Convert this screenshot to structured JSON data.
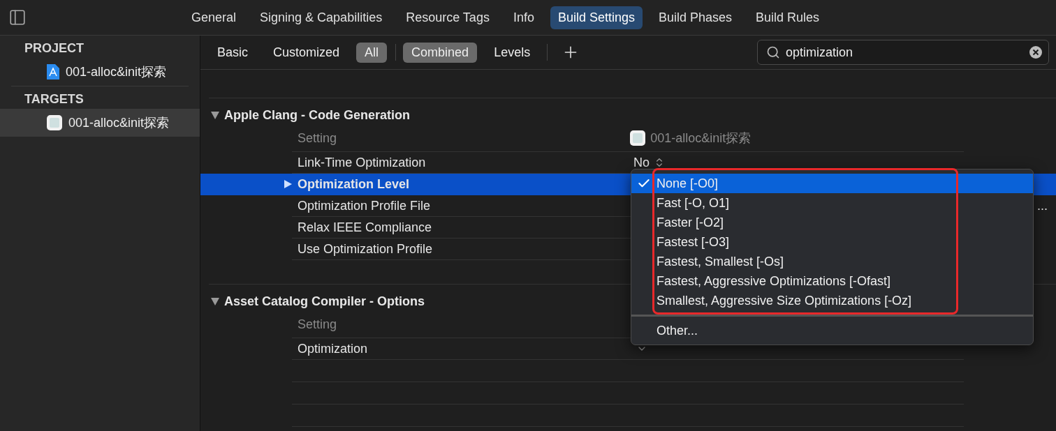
{
  "tabs": [
    {
      "label": "General",
      "selected": false
    },
    {
      "label": "Signing & Capabilities",
      "selected": false
    },
    {
      "label": "Resource Tags",
      "selected": false
    },
    {
      "label": "Info",
      "selected": false
    },
    {
      "label": "Build Settings",
      "selected": true
    },
    {
      "label": "Build Phases",
      "selected": false
    },
    {
      "label": "Build Rules",
      "selected": false
    }
  ],
  "sidebar": {
    "groups": [
      {
        "title": "PROJECT",
        "items": [
          {
            "label": "001-alloc&init探索",
            "kind": "project",
            "selected": false
          }
        ]
      },
      {
        "title": "TARGETS",
        "items": [
          {
            "label": "001-alloc&init探索",
            "kind": "target",
            "selected": true
          }
        ]
      }
    ]
  },
  "filter": {
    "scope": [
      {
        "label": "Basic",
        "selected": false
      },
      {
        "label": "Customized",
        "selected": false
      },
      {
        "label": "All",
        "selected": true
      }
    ],
    "view": [
      {
        "label": "Combined",
        "selected": true
      },
      {
        "label": "Levels",
        "selected": false
      }
    ],
    "search": {
      "value": "optimization"
    }
  },
  "sections": [
    {
      "title": "Apple Clang - Code Generation",
      "expanded": true,
      "header": {
        "label": "Setting",
        "target": "001-alloc&init探索"
      },
      "rows": [
        {
          "name": "Link-Time Optimization",
          "kind": "stepper",
          "value": "No",
          "selected": false
        },
        {
          "name": "Optimization Level",
          "kind": "text",
          "selected": true
        },
        {
          "name": "Optimization Profile File",
          "kind": "text",
          "value": "...",
          "selected": false
        },
        {
          "name": "Relax IEEE Compliance",
          "kind": "text",
          "selected": false
        },
        {
          "name": "Use Optimization Profile",
          "kind": "text",
          "selected": false
        }
      ]
    },
    {
      "title": "Asset Catalog Compiler - Options",
      "expanded": true,
      "header": {
        "label": "Setting"
      },
      "rows": [
        {
          "name": "Optimization",
          "kind": "popup",
          "selected": false
        }
      ]
    }
  ],
  "popup_menu": {
    "highlighted": true,
    "items": [
      {
        "label": "None [-O0]",
        "selected": true
      },
      {
        "label": "Fast [-O, O1]",
        "selected": false
      },
      {
        "label": "Faster [-O2]",
        "selected": false
      },
      {
        "label": "Fastest [-O3]",
        "selected": false
      },
      {
        "label": "Fastest, Smallest [-Os]",
        "selected": false
      },
      {
        "label": "Fastest, Aggressive Optimizations [-Ofast]",
        "selected": false
      },
      {
        "label": "Smallest, Aggressive Size Optimizations [-Oz]",
        "selected": false
      }
    ],
    "other": "Other..."
  }
}
